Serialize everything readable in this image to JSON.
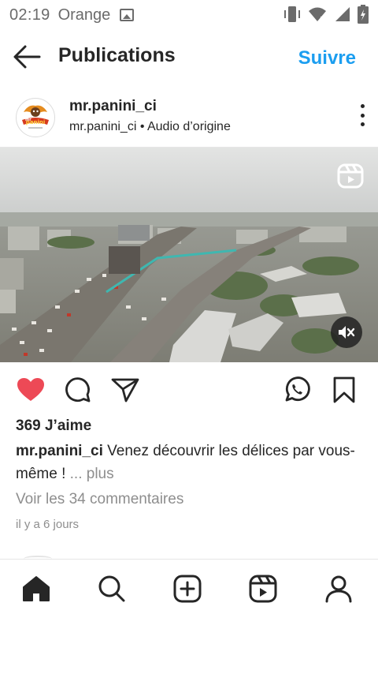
{
  "status_bar": {
    "time": "02:19",
    "carrier": "Orange",
    "icons": [
      "image-notification-icon",
      "vibrate-icon",
      "wifi-icon",
      "cell-signal-icon",
      "battery-icon"
    ]
  },
  "header": {
    "title": "Publications",
    "follow_label": "Suivre",
    "back_icon": "arrow-left-icon",
    "accent_color": "#1c9ef0"
  },
  "post": {
    "username": "mr.panini_ci",
    "sub_username": "mr.panini_ci",
    "separator": " • ",
    "audio": "Audio d’origine",
    "avatar_logo_text": "mr panini",
    "likes": "369 J’aime",
    "caption_user": "mr.panini_ci",
    "caption_text": " Venez découvrir les délices par vous-même !",
    "caption_more": " ... plus",
    "comments_link": "Voir les 34 commentaires",
    "time_ago": "il y a 6 jours",
    "liked": true,
    "like_color": "#ed4956",
    "muted": true
  },
  "actions": [
    "heart-icon",
    "comment-icon",
    "share-icon",
    "whatsapp-icon",
    "bookmark-icon"
  ],
  "bottom_nav": [
    "home-icon",
    "search-icon",
    "create-icon",
    "reels-icon",
    "profile-icon"
  ]
}
